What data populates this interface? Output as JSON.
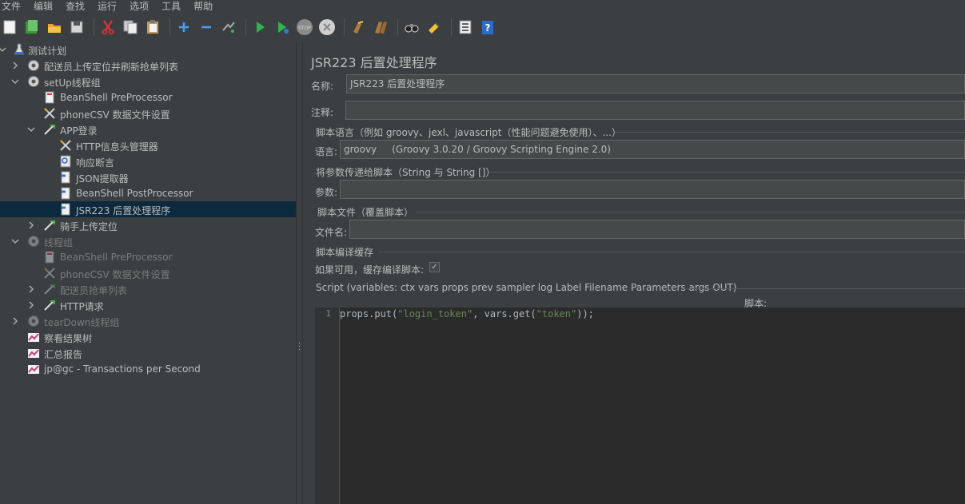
{
  "menu": [
    "文件",
    "编辑",
    "查找",
    "运行",
    "选项",
    "工具",
    "帮助"
  ],
  "toolbar": {
    "buttons": [
      "new-icon",
      "templates-icon",
      "open-icon",
      "save-icon",
      "cut-icon",
      "copy-icon",
      "paste-icon",
      "expand-icon",
      "collapse-icon",
      "toggle-icon",
      "start-icon",
      "start-no-pause-icon",
      "stop-icon",
      "shutdown-icon",
      "clear-icon",
      "clear-all-icon",
      "search-icon",
      "reset-search-icon",
      "function-helper-icon",
      "help-icon"
    ]
  },
  "tree": {
    "items": [
      {
        "label": "测试计划",
        "level": 0,
        "arrow": "down",
        "icon": "flask-icon",
        "disabled": false,
        "selected": false
      },
      {
        "label": "配送员上传定位并刷新抢单列表",
        "level": 1,
        "arrow": "right",
        "icon": "gear-icon",
        "disabled": false,
        "selected": false
      },
      {
        "label": "setUp线程组",
        "level": 1,
        "arrow": "down",
        "icon": "gear-icon",
        "disabled": false,
        "selected": false
      },
      {
        "label": "BeanShell PreProcessor",
        "level": 2,
        "arrow": "",
        "icon": "preprocessor-icon",
        "disabled": false,
        "selected": false
      },
      {
        "label": "phoneCSV 数据文件设置",
        "level": 2,
        "arrow": "",
        "icon": "config-icon",
        "disabled": false,
        "selected": false
      },
      {
        "label": "APP登录",
        "level": 2,
        "arrow": "down",
        "icon": "sampler-icon",
        "disabled": false,
        "selected": false
      },
      {
        "label": "HTTP信息头管理器",
        "level": 3,
        "arrow": "",
        "icon": "config-icon",
        "disabled": false,
        "selected": false
      },
      {
        "label": "响应断言",
        "level": 3,
        "arrow": "",
        "icon": "assertion-icon",
        "disabled": false,
        "selected": false
      },
      {
        "label": "JSON提取器",
        "level": 3,
        "arrow": "",
        "icon": "postprocessor-icon",
        "disabled": false,
        "selected": false
      },
      {
        "label": "BeanShell PostProcessor",
        "level": 3,
        "arrow": "",
        "icon": "postprocessor-icon",
        "disabled": false,
        "selected": false
      },
      {
        "label": "JSR223 后置处理程序",
        "level": 3,
        "arrow": "",
        "icon": "postprocessor-icon",
        "disabled": false,
        "selected": true
      },
      {
        "label": "骑手上传定位",
        "level": 2,
        "arrow": "right",
        "icon": "sampler-icon",
        "disabled": false,
        "selected": false
      },
      {
        "label": "线程组",
        "level": 1,
        "arrow": "down",
        "icon": "gear-icon",
        "disabled": true,
        "selected": false
      },
      {
        "label": "BeanShell PreProcessor",
        "level": 2,
        "arrow": "",
        "icon": "preprocessor-icon",
        "disabled": true,
        "selected": false
      },
      {
        "label": "phoneCSV 数据文件设置",
        "level": 2,
        "arrow": "",
        "icon": "config-icon",
        "disabled": true,
        "selected": false
      },
      {
        "label": "配送员抢单列表",
        "level": 2,
        "arrow": "right",
        "icon": "sampler-icon",
        "disabled": true,
        "selected": false
      },
      {
        "label": "HTTP请求",
        "level": 2,
        "arrow": "right",
        "icon": "sampler-icon",
        "disabled": false,
        "selected": false
      },
      {
        "label": "tearDown线程组",
        "level": 1,
        "arrow": "right",
        "icon": "gear-icon",
        "disabled": true,
        "selected": false
      },
      {
        "label": "察看结果树",
        "level": 1,
        "arrow": "",
        "icon": "listener-icon",
        "disabled": false,
        "selected": false
      },
      {
        "label": "汇总报告",
        "level": 1,
        "arrow": "",
        "icon": "listener-icon",
        "disabled": false,
        "selected": false
      },
      {
        "label": "jp@gc - Transactions per Second",
        "level": 1,
        "arrow": "",
        "icon": "listener-icon",
        "disabled": false,
        "selected": false
      }
    ]
  },
  "panel": {
    "title": "JSR223 后置处理程序",
    "name_label": "名称:",
    "name_value": "JSR223 后置处理程序",
    "comment_label": "注释:",
    "comment_value": "",
    "lang_section": "脚本语言（例如 groovy、jexl、javascript（性能问题避免使用）、...）",
    "lang_label": "语言:",
    "lang_value": "groovy     (Groovy 3.0.20 / Groovy Scripting Engine 2.0)",
    "params_section": "将参数传递给脚本（String 与 String []）",
    "params_label": "参数:",
    "params_value": "",
    "file_section": "脚本文件（覆盖脚本）",
    "file_label": "文件名:",
    "file_value": "",
    "cache_section": "脚本编译缓存",
    "cache_label": "如果可用，缓存编译脚本:",
    "cache_checked": true,
    "script_section": "Script (variables: ctx vars props prev sampler log Label Filename Parameters args OUT)",
    "script_label": "脚本:",
    "line_number": "1",
    "code_prefix": "props.put(",
    "code_str1": "\"login_token\"",
    "code_mid": ", vars.get(",
    "code_str2": "\"token\"",
    "code_suffix": "));"
  }
}
